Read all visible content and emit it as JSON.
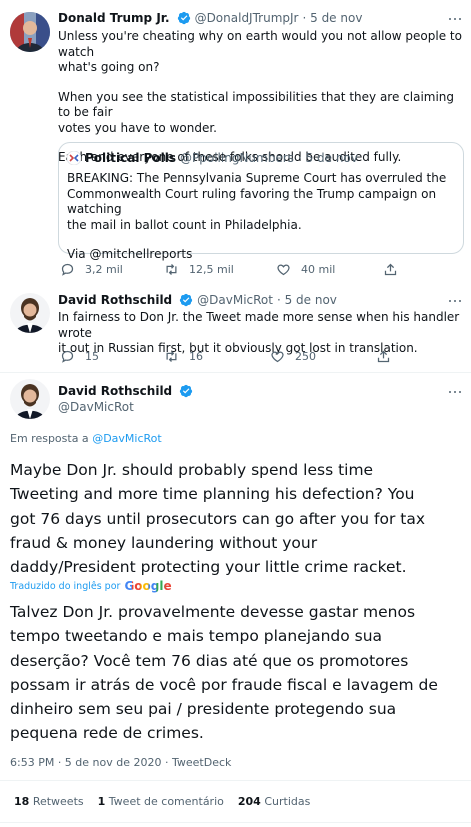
{
  "tweet1": {
    "name": "Donald Trump Jr.",
    "handle": "@DonaldJTrumpJr",
    "date": "· 5 de nov",
    "lines": [
      "Unless you're cheating why on earth would you not allow people to watch",
      "what's going on?",
      "When you see the statistical impossibilities that they are claiming to be fair",
      "votes you have to wonder.",
      "Each and everyone of these folks should be audited fully."
    ],
    "quote": {
      "name": "Political Polls",
      "handle": "@PpollingNumbers",
      "date": "· 5 de nov",
      "lines": [
        "BREAKING: The Pennsylvania Supreme Court has overruled the",
        "Commonwealth Court ruling favoring the Trump campaign on watching",
        "the mail in ballot count in Philadelphia.",
        "Via @mitchellreports"
      ]
    },
    "replies": "3,2 mil",
    "retweets": "12,5 mil",
    "likes": "40 mil"
  },
  "tweet2": {
    "name": "David Rothschild",
    "handle": "@DavMicRot",
    "date": "· 5 de nov",
    "lines": [
      "In fairness to Don Jr. the Tweet made more sense when his handler wrote",
      "it out in Russian first, but it obviously got lost in translation."
    ],
    "replies": "15",
    "retweets": "16",
    "likes": "250"
  },
  "main": {
    "name": "David Rothschild",
    "handle": "@DavMicRot",
    "reply_prefix": "Em resposta a",
    "reply_to": "@DavMicRot",
    "lines": [
      "Maybe Don Jr. should probably spend less time",
      "Tweeting and more time planning his defection? You",
      "got 76 days until prosecutors can go after you for tax",
      "fraud & money laundering without your",
      "daddy/President protecting your little crime racket."
    ],
    "translated_by": "Traduzido do inglês por",
    "google": "Google",
    "translation_lines": [
      "Talvez Don Jr. provavelmente devesse gastar menos",
      "tempo tweetando e mais tempo planejando sua",
      "deserção? Você tem 76 dias até que os promotores",
      "possam ir atrás de você por fraude fiscal e lavagem de",
      "dinheiro sem seu pai / presidente protegendo sua",
      "pequena rede de crimes."
    ],
    "meta": "6:53 PM · 5 de nov de 2020 · TweetDeck",
    "stats": {
      "retweets_num": "18",
      "retweets_label": "Retweets",
      "comments_num": "1",
      "comments_label": "Tweet de comentário",
      "likes_num": "204",
      "likes_label": "Curtidas"
    }
  },
  "colors": {
    "accent": "#1d9bf0",
    "secondary": "#536471",
    "border": "#cfd9de"
  }
}
